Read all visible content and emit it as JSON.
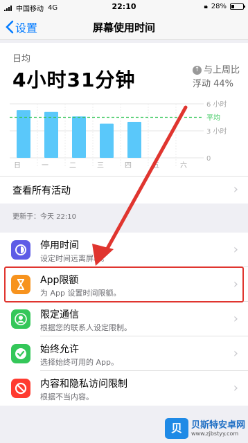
{
  "status_bar": {
    "carrier": "中国移动",
    "network": "4G",
    "time": "22:10",
    "battery": "28%",
    "battery_level": 0.28
  },
  "nav": {
    "back_label": "设置",
    "title": "屏幕使用时间"
  },
  "summary": {
    "label": "日均",
    "total": "4小时31分钟",
    "compare_line1": "与上周比",
    "compare_line2": "浮动 44%",
    "see_all": "查看所有活动"
  },
  "chart_data": {
    "type": "bar",
    "categories": [
      "日",
      "一",
      "二",
      "三",
      "四",
      "五",
      "六"
    ],
    "values": [
      5.3,
      5.1,
      4.6,
      3.8,
      4.0,
      null,
      null
    ],
    "ylim": [
      0,
      6
    ],
    "average": 4.5,
    "y_ticks": [
      "6 小时",
      "3 小时",
      "0"
    ],
    "avg_label": "平均",
    "bar_color": "#5ac8fa",
    "avg_color": "#34c759",
    "grid": true
  },
  "updated": "更新于：今天 22:10",
  "items": [
    {
      "title": "停用时间",
      "subtitle": "设定时间远离屏幕。",
      "icon": "downtime-icon",
      "color": "#5e5ce6"
    },
    {
      "title": "App限额",
      "subtitle": "为 App 设置时间限额。",
      "icon": "hourglass-icon",
      "color": "#f7931e"
    },
    {
      "title": "限定通信",
      "subtitle": "根据您的联系人设定限制。",
      "icon": "contact-icon",
      "color": "#34c759"
    },
    {
      "title": "始终允许",
      "subtitle": "选择始终可用的 App。",
      "icon": "checkmark-icon",
      "color": "#34c759"
    },
    {
      "title": "内容和隐私访问限制",
      "subtitle": "根据不当内容。",
      "icon": "restrict-icon",
      "color": "#ff3b30"
    }
  ],
  "watermark": {
    "badge": "贝",
    "name": "贝斯特安卓网",
    "url": "www.zjbstyy.com"
  }
}
